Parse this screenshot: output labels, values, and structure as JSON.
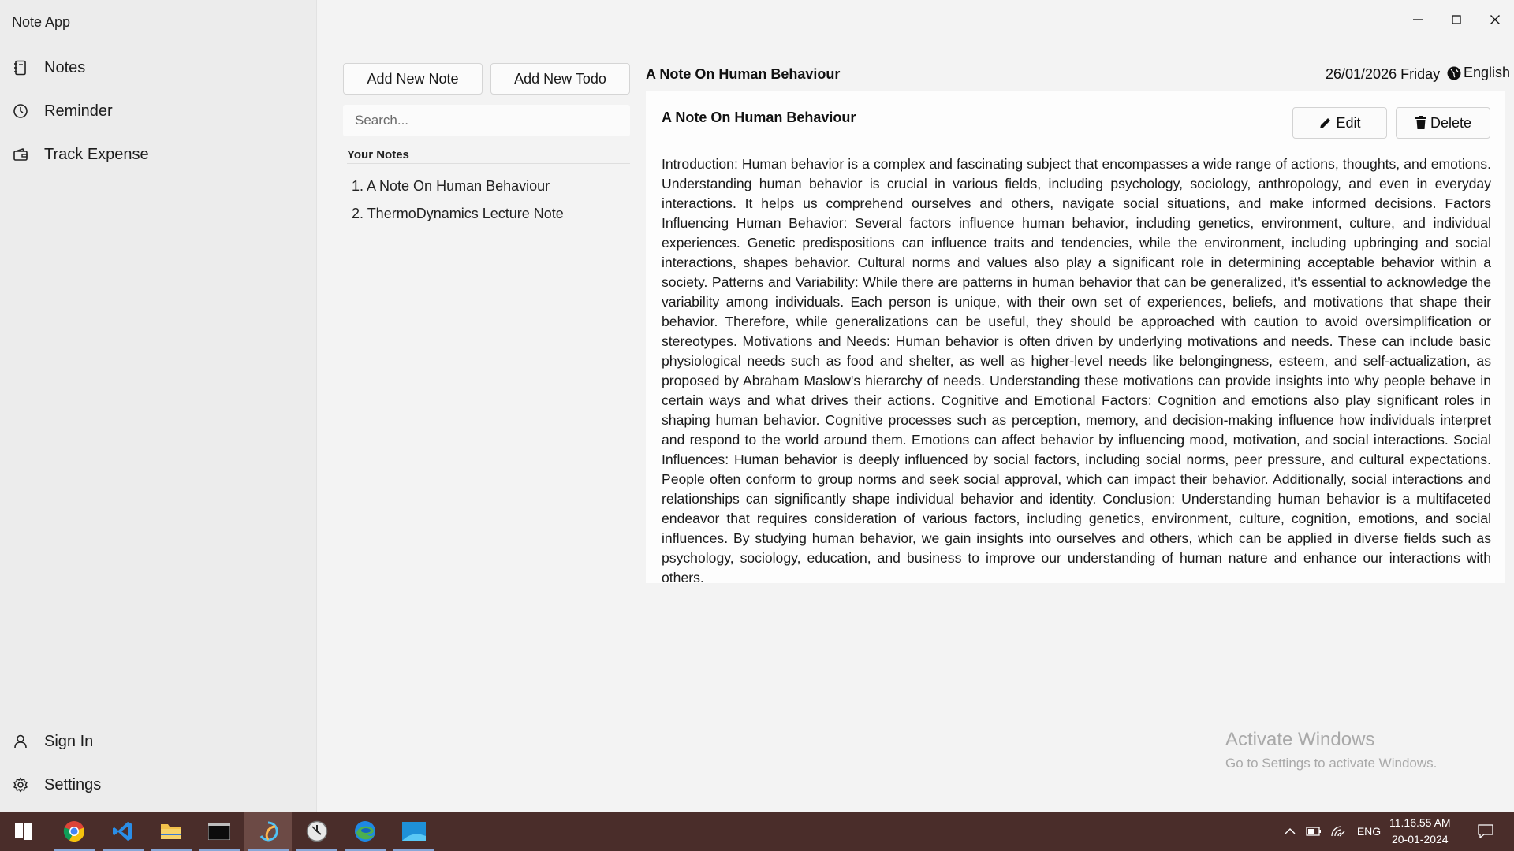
{
  "window": {
    "app_title": "Note App"
  },
  "sidebar": {
    "items": [
      {
        "label": "Notes",
        "icon": "notebook-icon"
      },
      {
        "label": "Reminder",
        "icon": "clock-icon"
      },
      {
        "label": "Track Expense",
        "icon": "wallet-icon"
      }
    ],
    "bottom_items": [
      {
        "label": "Sign In",
        "icon": "user-icon"
      },
      {
        "label": "Settings",
        "icon": "gear-icon"
      }
    ]
  },
  "toolbar": {
    "add_note_label": "Add New Note",
    "add_todo_label": "Add New Todo"
  },
  "search": {
    "placeholder": "Search...",
    "value": ""
  },
  "notes_list": {
    "heading": "Your Notes",
    "items": [
      "1. A Note On Human Behaviour",
      "2. ThermoDynamics Lecture Note"
    ]
  },
  "header": {
    "title": "A Note On Human Behaviour",
    "date": "26/01/2026 Friday",
    "language": "English"
  },
  "note": {
    "title": "A Note On Human Behaviour",
    "edit_label": "Edit",
    "delete_label": "Delete",
    "body": "Introduction: Human behavior is a complex and fascinating subject that encompasses a wide range of actions, thoughts, and emotions. Understanding human behavior is crucial in various fields, including psychology, sociology, anthropology, and even in everyday interactions. It helps us comprehend ourselves and others, navigate social situations, and make informed decisions. Factors Influencing Human Behavior: Several factors influence human behavior, including genetics, environment, culture, and individual experiences. Genetic predispositions can influence traits and tendencies, while the environment, including upbringing and social interactions, shapes behavior. Cultural norms and values also play a significant role in determining acceptable behavior within a society. Patterns and Variability: While there are patterns in human behavior that can be generalized, it's essential to acknowledge the variability among individuals. Each person is unique, with their own set of experiences, beliefs, and motivations that shape their behavior. Therefore, while generalizations can be useful, they should be approached with caution to avoid oversimplification or stereotypes. Motivations and Needs: Human behavior is often driven by underlying motivations and needs. These can include basic physiological needs such as food and shelter, as well as higher-level needs like belongingness, esteem, and self-actualization, as proposed by Abraham Maslow's hierarchy of needs. Understanding these motivations can provide insights into why people behave in certain ways and what drives their actions. Cognitive and Emotional Factors: Cognition and emotions also play significant roles in shaping human behavior. Cognitive processes such as perception, memory, and decision-making influence how individuals interpret and respond to the world around them. Emotions can affect behavior by influencing mood, motivation, and social interactions. Social Influences: Human behavior is deeply influenced by social factors, including social norms, peer pressure, and cultural expectations. People often conform to group norms and seek social approval, which can impact their behavior. Additionally, social interactions and relationships can significantly shape individual behavior and identity. Conclusion: Understanding human behavior is a multifaceted endeavor that requires consideration of various factors, including genetics, environment, culture, cognition, emotions, and social influences. By studying human behavior, we gain insights into ourselves and others, which can be applied in diverse fields such as psychology, sociology, education, and business to improve our understanding of human nature and enhance our interactions with others."
  },
  "watermark": {
    "line1": "Activate Windows",
    "line2": "Go to Settings to activate Windows."
  },
  "taskbar": {
    "apps": [
      "windows-start-icon",
      "chrome-icon",
      "vscode-icon",
      "file-explorer-icon",
      "terminal-icon",
      "note-app-icon",
      "clock-app-icon",
      "edge-icon",
      "mail-icon"
    ],
    "lang": "ENG",
    "time": "11.16.55 AM",
    "date": "20-01-2024"
  },
  "colors": {
    "taskbar_bg": "#4a2d2a",
    "active_underline": "#88a7d8"
  }
}
